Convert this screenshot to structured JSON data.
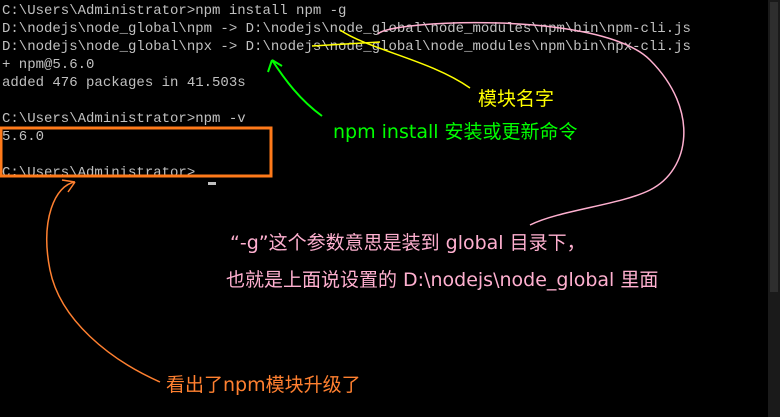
{
  "terminal": {
    "lines": [
      "C:\\Users\\Administrator>npm install npm -g",
      "D:\\nodejs\\node_global\\npm -> D:\\nodejs\\node_global\\node_modules\\npm\\bin\\npm-cli.js",
      "D:\\nodejs\\node_global\\npx -> D:\\nodejs\\node_global\\node_modules\\npm\\bin\\npx-cli.js",
      "+ npm@5.6.0",
      "added 476 packages in 41.503s",
      "",
      "C:\\Users\\Administrator>npm -v",
      "5.6.0",
      "",
      "C:\\Users\\Administrator>"
    ]
  },
  "annotations": {
    "module_name": "模块名字",
    "install_desc": "npm install 安装或更新命令",
    "g_param_line1": "“-g”这个参数意思是装到 global 目录下，",
    "g_param_line2": "也就是上面说设置的 D:\\nodejs\\node_global 里面",
    "upgraded": "看出了npm模块升级了"
  },
  "colors": {
    "background": "#000000",
    "terminal_text": "#c0c0c0",
    "yellow": "#ffff00",
    "green": "#00ff00",
    "pink": "#ffb0d0",
    "orange": "#ff8030",
    "orange_box": "#ff7a1a"
  }
}
